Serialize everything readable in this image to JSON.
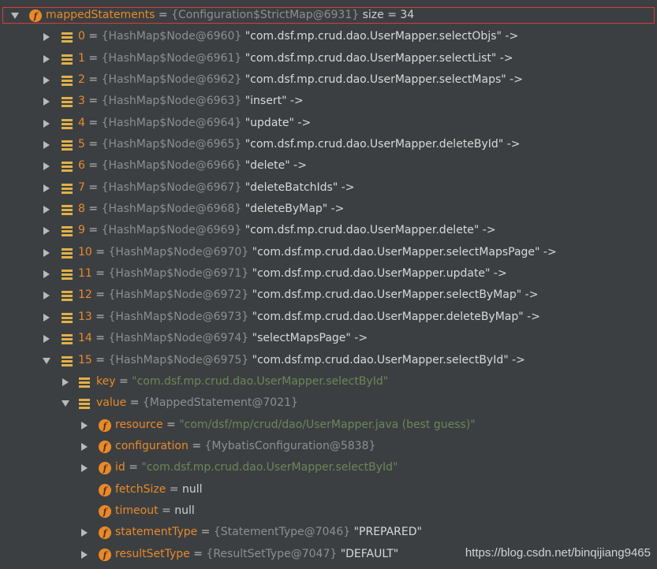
{
  "colors": {
    "background": "#3c3f41",
    "field_name": "#e88a2b",
    "type_ref": "#8e8e8e",
    "string_value": "#d8d8d8",
    "green_string": "#6a8759",
    "plain": "#d0d0d0",
    "highlight_border": "#d83b3b",
    "field_icon": "#e88a2b",
    "list_icon": "#e0b04a"
  },
  "tree": [
    {
      "level": 0,
      "toggle": "expanded",
      "icon": "field-icon",
      "highlight": true,
      "parts": [
        {
          "cls": "nm",
          "t": "mappedStatements"
        },
        {
          "cls": "eq",
          "t": " = "
        },
        {
          "cls": "ty",
          "t": "{Configuration$StrictMap@6931}"
        },
        {
          "cls": "sz",
          "t": "  size = 34"
        }
      ]
    },
    {
      "level": 1,
      "toggle": "collapsed",
      "icon": "list-entry-icon",
      "parts": [
        {
          "cls": "nm",
          "t": "0"
        },
        {
          "cls": "eq",
          "t": " = "
        },
        {
          "cls": "ty",
          "t": "{HashMap$Node@6960}"
        },
        {
          "cls": "st",
          "t": " \"com.dsf.mp.crud.dao.UserMapper.selectObjs\" ->"
        }
      ]
    },
    {
      "level": 1,
      "toggle": "collapsed",
      "icon": "list-entry-icon",
      "parts": [
        {
          "cls": "nm",
          "t": "1"
        },
        {
          "cls": "eq",
          "t": " = "
        },
        {
          "cls": "ty",
          "t": "{HashMap$Node@6961}"
        },
        {
          "cls": "st",
          "t": " \"com.dsf.mp.crud.dao.UserMapper.selectList\" ->"
        }
      ]
    },
    {
      "level": 1,
      "toggle": "collapsed",
      "icon": "list-entry-icon",
      "parts": [
        {
          "cls": "nm",
          "t": "2"
        },
        {
          "cls": "eq",
          "t": " = "
        },
        {
          "cls": "ty",
          "t": "{HashMap$Node@6962}"
        },
        {
          "cls": "st",
          "t": " \"com.dsf.mp.crud.dao.UserMapper.selectMaps\" ->"
        }
      ]
    },
    {
      "level": 1,
      "toggle": "collapsed",
      "icon": "list-entry-icon",
      "parts": [
        {
          "cls": "nm",
          "t": "3"
        },
        {
          "cls": "eq",
          "t": " = "
        },
        {
          "cls": "ty",
          "t": "{HashMap$Node@6963}"
        },
        {
          "cls": "st",
          "t": " \"insert\" ->"
        }
      ]
    },
    {
      "level": 1,
      "toggle": "collapsed",
      "icon": "list-entry-icon",
      "parts": [
        {
          "cls": "nm",
          "t": "4"
        },
        {
          "cls": "eq",
          "t": " = "
        },
        {
          "cls": "ty",
          "t": "{HashMap$Node@6964}"
        },
        {
          "cls": "st",
          "t": " \"update\" ->"
        }
      ]
    },
    {
      "level": 1,
      "toggle": "collapsed",
      "icon": "list-entry-icon",
      "parts": [
        {
          "cls": "nm",
          "t": "5"
        },
        {
          "cls": "eq",
          "t": " = "
        },
        {
          "cls": "ty",
          "t": "{HashMap$Node@6965}"
        },
        {
          "cls": "st",
          "t": " \"com.dsf.mp.crud.dao.UserMapper.deleteById\" ->"
        }
      ]
    },
    {
      "level": 1,
      "toggle": "collapsed",
      "icon": "list-entry-icon",
      "parts": [
        {
          "cls": "nm",
          "t": "6"
        },
        {
          "cls": "eq",
          "t": " = "
        },
        {
          "cls": "ty",
          "t": "{HashMap$Node@6966}"
        },
        {
          "cls": "st",
          "t": " \"delete\" ->"
        }
      ]
    },
    {
      "level": 1,
      "toggle": "collapsed",
      "icon": "list-entry-icon",
      "parts": [
        {
          "cls": "nm",
          "t": "7"
        },
        {
          "cls": "eq",
          "t": " = "
        },
        {
          "cls": "ty",
          "t": "{HashMap$Node@6967}"
        },
        {
          "cls": "st",
          "t": " \"deleteBatchIds\" ->"
        }
      ]
    },
    {
      "level": 1,
      "toggle": "collapsed",
      "icon": "list-entry-icon",
      "parts": [
        {
          "cls": "nm",
          "t": "8"
        },
        {
          "cls": "eq",
          "t": " = "
        },
        {
          "cls": "ty",
          "t": "{HashMap$Node@6968}"
        },
        {
          "cls": "st",
          "t": " \"deleteByMap\" ->"
        }
      ]
    },
    {
      "level": 1,
      "toggle": "collapsed",
      "icon": "list-entry-icon",
      "parts": [
        {
          "cls": "nm",
          "t": "9"
        },
        {
          "cls": "eq",
          "t": " = "
        },
        {
          "cls": "ty",
          "t": "{HashMap$Node@6969}"
        },
        {
          "cls": "st",
          "t": " \"com.dsf.mp.crud.dao.UserMapper.delete\" ->"
        }
      ]
    },
    {
      "level": 1,
      "toggle": "collapsed",
      "icon": "list-entry-icon",
      "parts": [
        {
          "cls": "nm",
          "t": "10"
        },
        {
          "cls": "eq",
          "t": " = "
        },
        {
          "cls": "ty",
          "t": "{HashMap$Node@6970}"
        },
        {
          "cls": "st",
          "t": " \"com.dsf.mp.crud.dao.UserMapper.selectMapsPage\" ->"
        }
      ]
    },
    {
      "level": 1,
      "toggle": "collapsed",
      "icon": "list-entry-icon",
      "parts": [
        {
          "cls": "nm",
          "t": "11"
        },
        {
          "cls": "eq",
          "t": " = "
        },
        {
          "cls": "ty",
          "t": "{HashMap$Node@6971}"
        },
        {
          "cls": "st",
          "t": " \"com.dsf.mp.crud.dao.UserMapper.update\" ->"
        }
      ]
    },
    {
      "level": 1,
      "toggle": "collapsed",
      "icon": "list-entry-icon",
      "parts": [
        {
          "cls": "nm",
          "t": "12"
        },
        {
          "cls": "eq",
          "t": " = "
        },
        {
          "cls": "ty",
          "t": "{HashMap$Node@6972}"
        },
        {
          "cls": "st",
          "t": " \"com.dsf.mp.crud.dao.UserMapper.selectByMap\" ->"
        }
      ]
    },
    {
      "level": 1,
      "toggle": "collapsed",
      "icon": "list-entry-icon",
      "parts": [
        {
          "cls": "nm",
          "t": "13"
        },
        {
          "cls": "eq",
          "t": " = "
        },
        {
          "cls": "ty",
          "t": "{HashMap$Node@6973}"
        },
        {
          "cls": "st",
          "t": " \"com.dsf.mp.crud.dao.UserMapper.deleteByMap\" ->"
        }
      ]
    },
    {
      "level": 1,
      "toggle": "collapsed",
      "icon": "list-entry-icon",
      "parts": [
        {
          "cls": "nm",
          "t": "14"
        },
        {
          "cls": "eq",
          "t": " = "
        },
        {
          "cls": "ty",
          "t": "{HashMap$Node@6974}"
        },
        {
          "cls": "st",
          "t": " \"selectMapsPage\" ->"
        }
      ]
    },
    {
      "level": 1,
      "toggle": "expanded",
      "icon": "list-entry-icon",
      "parts": [
        {
          "cls": "nm",
          "t": "15"
        },
        {
          "cls": "eq",
          "t": " = "
        },
        {
          "cls": "ty",
          "t": "{HashMap$Node@6975}"
        },
        {
          "cls": "st",
          "t": " \"com.dsf.mp.crud.dao.UserMapper.selectById\" ->"
        }
      ]
    },
    {
      "level": 2,
      "toggle": "collapsed",
      "icon": "list-entry-icon",
      "parts": [
        {
          "cls": "nm",
          "t": "key"
        },
        {
          "cls": "eq",
          "t": " = "
        },
        {
          "cls": "gs",
          "t": "\"com.dsf.mp.crud.dao.UserMapper.selectById\""
        }
      ]
    },
    {
      "level": 2,
      "toggle": "expanded",
      "icon": "list-entry-icon",
      "parts": [
        {
          "cls": "nm",
          "t": "value"
        },
        {
          "cls": "eq",
          "t": " = "
        },
        {
          "cls": "ty",
          "t": "{MappedStatement@7021}"
        }
      ]
    },
    {
      "level": 3,
      "toggle": "collapsed",
      "icon": "field-icon",
      "parts": [
        {
          "cls": "nm",
          "t": "resource"
        },
        {
          "cls": "eq",
          "t": " = "
        },
        {
          "cls": "gs",
          "t": "\"com/dsf/mp/crud/dao/UserMapper.java (best guess)\""
        }
      ]
    },
    {
      "level": 3,
      "toggle": "collapsed",
      "icon": "field-icon",
      "parts": [
        {
          "cls": "nm",
          "t": "configuration"
        },
        {
          "cls": "eq",
          "t": " = "
        },
        {
          "cls": "ty",
          "t": "{MybatisConfiguration@5838}"
        }
      ]
    },
    {
      "level": 3,
      "toggle": "collapsed",
      "icon": "field-icon",
      "parts": [
        {
          "cls": "nm",
          "t": "id"
        },
        {
          "cls": "eq",
          "t": " = "
        },
        {
          "cls": "gs",
          "t": "\"com.dsf.mp.crud.dao.UserMapper.selectById\""
        }
      ]
    },
    {
      "level": 3,
      "toggle": "none",
      "icon": "field-icon",
      "parts": [
        {
          "cls": "nm",
          "t": "fetchSize"
        },
        {
          "cls": "eq",
          "t": " = "
        },
        {
          "cls": "pl",
          "t": "null"
        }
      ]
    },
    {
      "level": 3,
      "toggle": "none",
      "icon": "field-icon",
      "parts": [
        {
          "cls": "nm",
          "t": "timeout"
        },
        {
          "cls": "eq",
          "t": " = "
        },
        {
          "cls": "pl",
          "t": "null"
        }
      ]
    },
    {
      "level": 3,
      "toggle": "collapsed",
      "icon": "field-icon",
      "parts": [
        {
          "cls": "nm",
          "t": "statementType"
        },
        {
          "cls": "eq",
          "t": " = "
        },
        {
          "cls": "ty",
          "t": "{StatementType@7046}"
        },
        {
          "cls": "st",
          "t": " \"PREPARED\""
        }
      ]
    },
    {
      "level": 3,
      "toggle": "collapsed",
      "icon": "field-icon",
      "parts": [
        {
          "cls": "nm",
          "t": "resultSetType"
        },
        {
          "cls": "eq",
          "t": " = "
        },
        {
          "cls": "ty",
          "t": "{ResultSetType@7047}"
        },
        {
          "cls": "st",
          "t": " \"DEFAULT\""
        }
      ]
    }
  ],
  "watermark": "https://blog.csdn.net/binqijiang9465"
}
